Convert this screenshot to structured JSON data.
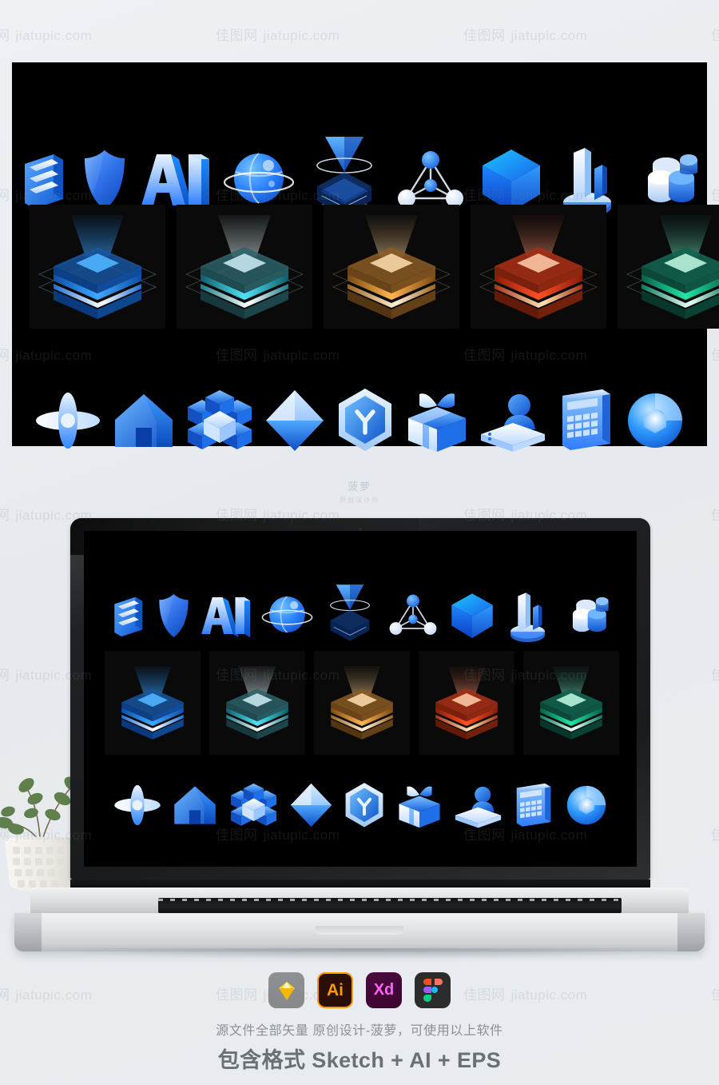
{
  "background_color": "#e9edf0",
  "watermark": {
    "cn": "佳图网",
    "url": "jiatupic.com"
  },
  "designer": {
    "name": "菠萝",
    "role": "原创设计师"
  },
  "preview": {
    "background": "#000000",
    "cell_background": "#0a0a0a",
    "row_top": [
      {
        "name": "document-list-icon",
        "glyph": "document-stack",
        "color": "#2f7dff"
      },
      {
        "name": "shield-icon",
        "glyph": "shield",
        "color": "#3d7dff"
      },
      {
        "name": "ai-text-icon",
        "glyph": "AI",
        "color": "#2f86ff"
      },
      {
        "name": "globe-planet-icon",
        "glyph": "globe-ring",
        "color": "#2f86ff"
      },
      {
        "name": "beam-cube-blue-icon",
        "glyph": "beam-layers",
        "color": "#1f6fd6"
      },
      {
        "name": "molecule-network-icon",
        "glyph": "molecule",
        "color": "#2f7dff"
      },
      {
        "name": "cube-icon",
        "glyph": "cube",
        "color": "#1f7bff"
      },
      {
        "name": "buildings-chart-icon",
        "glyph": "buildings",
        "color": "#3d8cff"
      },
      {
        "name": "database-cluster-icon",
        "glyph": "cylinders",
        "color": "#2f7dff"
      }
    ],
    "row_cells": [
      {
        "name": "layer-stack-blue",
        "accent": "#1f8cff",
        "glow": "#3ea8ff"
      },
      {
        "name": "layer-stack-teal",
        "accent": "#17c3d6",
        "glow": "#6fe4ef"
      },
      {
        "name": "layer-stack-orange",
        "accent": "#d98a2b",
        "glow": "#ffcf8a"
      },
      {
        "name": "layer-stack-red",
        "accent": "#e03a20",
        "glow": "#ff8a5c"
      },
      {
        "name": "layer-stack-green",
        "accent": "#0fb985",
        "glow": "#55ecbd"
      }
    ],
    "row_bottom": [
      {
        "name": "orbit-atom-icon",
        "glyph": "orbit",
        "color": "#2f7dff"
      },
      {
        "name": "house-icon",
        "glyph": "house",
        "color": "#1f7bff"
      },
      {
        "name": "cube-cluster-icon",
        "glyph": "cube-cluster",
        "color": "#2f86ff"
      },
      {
        "name": "diamond-icon",
        "glyph": "diamond",
        "color": "#2f86ff"
      },
      {
        "name": "hexagon-badge-icon",
        "glyph": "hex-badge",
        "color": "#1f7bff"
      },
      {
        "name": "gift-box-icon",
        "glyph": "gift",
        "color": "#2f86ff"
      },
      {
        "name": "user-profile-icon",
        "glyph": "user-tray",
        "color": "#2f7dff"
      },
      {
        "name": "calculator-icon",
        "glyph": "calculator",
        "color": "#4a90ff"
      },
      {
        "name": "gem-circle-icon",
        "glyph": "gem-circle",
        "color": "#1f8cff"
      }
    ]
  },
  "laptop": {
    "device": "macbook-pro-mockup",
    "lid_color": "#1a1b1d",
    "base_color": "#dfe2e5",
    "screen_background": "#000000"
  },
  "plant": {
    "pot_color": "#efeeea",
    "leaf_color": "#5f7f4d"
  },
  "footer": {
    "apps": [
      {
        "name": "sketch-app-icon",
        "label": ""
      },
      {
        "name": "illustrator-app-icon",
        "label": "Ai"
      },
      {
        "name": "xd-app-icon",
        "label": "Xd"
      },
      {
        "name": "figma-app-icon",
        "label": ""
      }
    ],
    "subtitle": "源文件全部矢量 原创设计-菠萝，可使用以上软件",
    "title": "包含格式 Sketch + AI + EPS"
  }
}
